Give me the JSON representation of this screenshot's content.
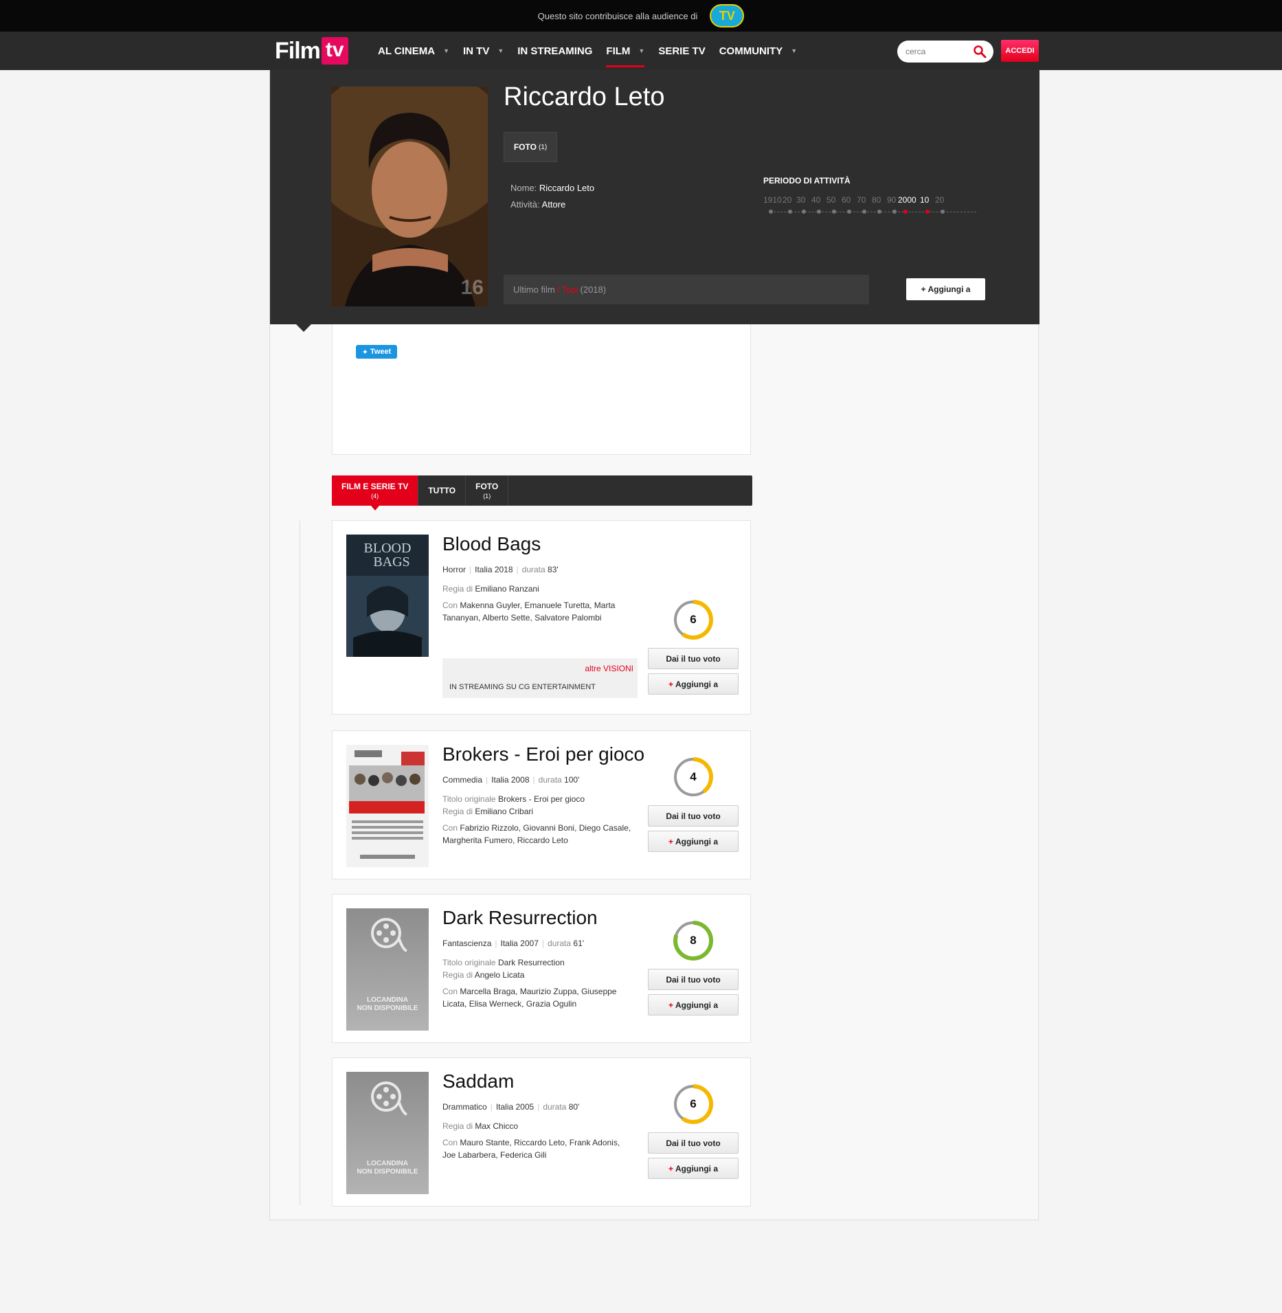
{
  "audience": {
    "text": "Questo sito contribuisce alla audience di",
    "logo": "TV"
  },
  "logo": {
    "film": "Film",
    "tv": "tv"
  },
  "nav": [
    {
      "label": "AL CINEMA",
      "dropdown": true,
      "active": false
    },
    {
      "label": "IN TV",
      "dropdown": true,
      "active": false
    },
    {
      "label": "IN STREAMING",
      "dropdown": false,
      "active": false
    },
    {
      "label": "FILM",
      "dropdown": true,
      "active": true
    },
    {
      "label": "SERIE TV",
      "dropdown": false,
      "active": false
    },
    {
      "label": "COMMUNITY",
      "dropdown": true,
      "active": false
    }
  ],
  "search": {
    "placeholder": "cerca"
  },
  "login": "ACCEDI",
  "person": {
    "name": "Riccardo Leto",
    "portrait_number": "16",
    "photo_tab": {
      "label": "FOTO",
      "count": "(1)"
    },
    "info": {
      "name_label": "Nome:",
      "name_value": "Riccardo Leto",
      "activity_label": "Attività:",
      "activity_value": "Attore"
    },
    "activity_title": "PERIODO DI ATTIVITÀ",
    "timeline": [
      {
        "label": "1910",
        "on": false
      },
      {
        "label": "20",
        "on": false
      },
      {
        "label": "30",
        "on": false
      },
      {
        "label": "40",
        "on": false
      },
      {
        "label": "50",
        "on": false
      },
      {
        "label": "60",
        "on": false
      },
      {
        "label": "70",
        "on": false
      },
      {
        "label": "80",
        "on": false
      },
      {
        "label": "90",
        "on": false
      },
      {
        "label": "2000",
        "on": true
      },
      {
        "label": "10",
        "on": true
      },
      {
        "label": "20",
        "on": false
      }
    ],
    "last_film": {
      "label": "Ultimo film",
      "title": "I Topi",
      "year": "(2018)"
    },
    "add_label": "+ Aggiungi a"
  },
  "tweet": "Tweet",
  "tabs": [
    {
      "label": "FILM E SERIE TV",
      "sub": "(4)",
      "active": true
    },
    {
      "label": "TUTTO",
      "sub": "",
      "active": false
    },
    {
      "label": "FOTO",
      "sub": "(1)",
      "active": false
    }
  ],
  "films": [
    {
      "title": "Blood Bags",
      "genre": "Horror",
      "country_year": "Italia 2018",
      "duration_label": "durata",
      "duration": "83'",
      "original_title": "",
      "director": "Emiliano Ranzani",
      "cast": "Makenna Guyler, Emanuele Turetta, Marta Tananyan, Alberto Sette, Salvatore Palombi",
      "score": 6,
      "score_color": "#f5b800",
      "poster": "blood-bags",
      "altre": "altre VISIONI",
      "stream": "IN STREAMING SU CG ENTERTAINMENT"
    },
    {
      "title": "Brokers - Eroi per gioco",
      "genre": "Commedia",
      "country_year": "Italia 2008",
      "duration_label": "durata",
      "duration": "100'",
      "original_title": "Brokers - Eroi per gioco",
      "director": "Emiliano Cribari",
      "cast": "Fabrizio Rizzolo, Giovanni Boni, Diego Casale, Margherita Fumero, Riccardo Leto",
      "score": 4,
      "score_color": "#f5b800",
      "poster": "brokers"
    },
    {
      "title": "Dark Resurrection",
      "genre": "Fantascienza",
      "country_year": "Italia 2007",
      "duration_label": "durata",
      "duration": "61'",
      "original_title": "Dark Resurrection",
      "director": "Angelo Licata",
      "cast": "Marcella Braga, Maurizio Zuppa, Giuseppe Licata, Elisa Werneck, Grazia Ogulin",
      "score": 8,
      "score_color": "#7cb82f",
      "poster": "placeholder"
    },
    {
      "title": "Saddam",
      "genre": "Drammatico",
      "country_year": "Italia 2005",
      "duration_label": "durata",
      "duration": "80'",
      "original_title": "",
      "director": "Max Chicco",
      "cast": "Mauro Stante, Riccardo Leto, Frank Adonis, Joe Labarbera, Federica Gili",
      "score": 6,
      "score_color": "#f5b800",
      "poster": "placeholder"
    }
  ],
  "labels": {
    "original_title": "Titolo originale",
    "director": "Regia di",
    "cast": "Con",
    "vote": "Dai il tuo voto",
    "add": "Aggiungi a",
    "poster_na_1": "LOCANDINA",
    "poster_na_2": "NON DISPONIBILE"
  }
}
